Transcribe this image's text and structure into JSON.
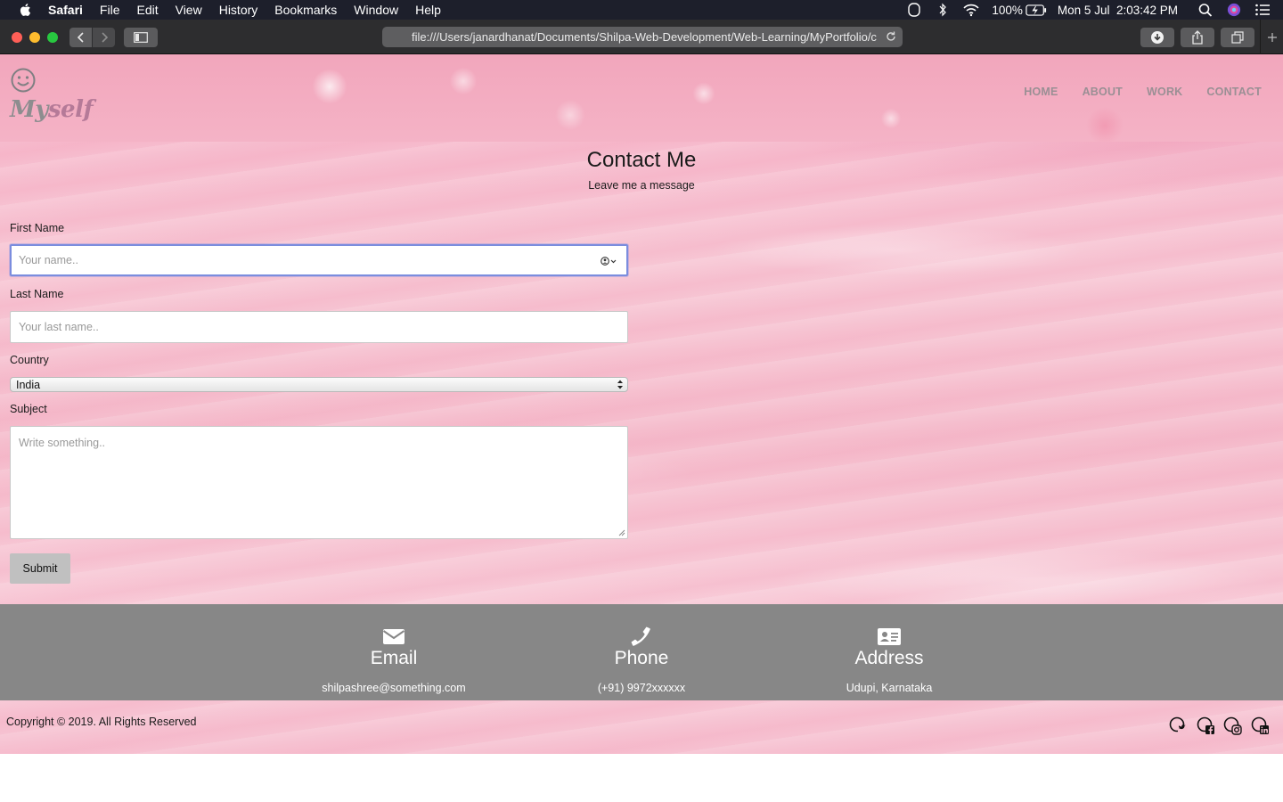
{
  "menubar": {
    "app": "Safari",
    "items": [
      "File",
      "Edit",
      "View",
      "History",
      "Bookmarks",
      "Window",
      "Help"
    ],
    "battery": "100%",
    "clock": "Mon 5 Jul  2:03:42 PM"
  },
  "browser": {
    "url": "file:///Users/janardhanat/Documents/Shilpa-Web-Development/Web-Learning/MyPortfolio/c"
  },
  "site": {
    "logo": {
      "part1": "My",
      "part2": "self"
    },
    "nav": [
      "HOME",
      "ABOUT",
      "WORK",
      "CONTACT"
    ]
  },
  "contact": {
    "title": "Contact Me",
    "subtitle": "Leave me a message",
    "first_name_label": "First Name",
    "first_name_placeholder": "Your name..",
    "last_name_label": "Last Name",
    "last_name_placeholder": "Your last name..",
    "country_label": "Country",
    "country_value": "India",
    "subject_label": "Subject",
    "subject_placeholder": "Write something..",
    "submit": "Submit"
  },
  "info": [
    {
      "icon": "envelope-icon",
      "heading": "Email",
      "value": "shilpashree@something.com"
    },
    {
      "icon": "phone-icon",
      "heading": "Phone",
      "value": "(+91) 9972xxxxxx"
    },
    {
      "icon": "address-card-icon",
      "heading": "Address",
      "value": "Udupi, Karnataka"
    }
  ],
  "footer": {
    "copyright": "Copyright © 2019. All Rights Reserved",
    "social": [
      "twitter-icon",
      "facebook-icon",
      "instagram-icon",
      "linkedin-icon"
    ]
  },
  "colors": {
    "contact_bar": "#878787",
    "focus_ring": "#7b8dde",
    "page_pink": "#f6b3c8"
  }
}
